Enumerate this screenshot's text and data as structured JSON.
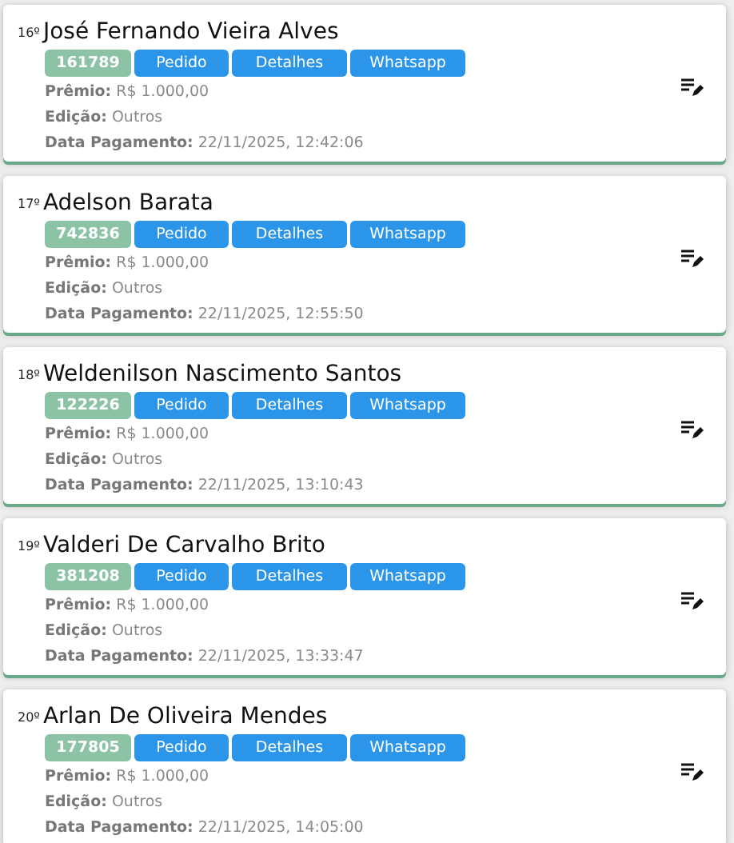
{
  "winners": [
    {
      "rank": "16º",
      "name": "José Fernando Vieira Alves",
      "code": "161789",
      "buttons": [
        "Pedido",
        "Detalhes",
        "Whatsapp"
      ],
      "fields": [
        {
          "label": "Prêmio:",
          "value": "R$ 1.000,00"
        },
        {
          "label": "Edição:",
          "value": "Outros"
        },
        {
          "label": "Data Pagamento:",
          "value": "22/11/2025, 12:42:06"
        }
      ]
    },
    {
      "rank": "17º",
      "name": "Adelson Barata",
      "code": "742836",
      "buttons": [
        "Pedido",
        "Detalhes",
        "Whatsapp"
      ],
      "fields": [
        {
          "label": "Prêmio:",
          "value": "R$ 1.000,00"
        },
        {
          "label": "Edição:",
          "value": "Outros"
        },
        {
          "label": "Data Pagamento:",
          "value": "22/11/2025, 12:55:50"
        }
      ]
    },
    {
      "rank": "18º",
      "name": "Weldenilson Nascimento Santos",
      "code": "122226",
      "buttons": [
        "Pedido",
        "Detalhes",
        "Whatsapp"
      ],
      "fields": [
        {
          "label": "Prêmio:",
          "value": "R$ 1.000,00"
        },
        {
          "label": "Edição:",
          "value": "Outros"
        },
        {
          "label": "Data Pagamento:",
          "value": "22/11/2025, 13:10:43"
        }
      ]
    },
    {
      "rank": "19º",
      "name": "Valderi De Carvalho Brito",
      "code": "381208",
      "buttons": [
        "Pedido",
        "Detalhes",
        "Whatsapp"
      ],
      "fields": [
        {
          "label": "Prêmio:",
          "value": "R$ 1.000,00"
        },
        {
          "label": "Edição:",
          "value": "Outros"
        },
        {
          "label": "Data Pagamento:",
          "value": "22/11/2025, 13:33:47"
        }
      ]
    },
    {
      "rank": "20º",
      "name": "Arlan De Oliveira Mendes",
      "code": "177805",
      "buttons": [
        "Pedido",
        "Detalhes",
        "Whatsapp"
      ],
      "fields": [
        {
          "label": "Prêmio:",
          "value": "R$ 1.000,00"
        },
        {
          "label": "Edição:",
          "value": "Outros"
        },
        {
          "label": "Data Pagamento:",
          "value": "22/11/2025, 14:05:00"
        }
      ]
    }
  ]
}
